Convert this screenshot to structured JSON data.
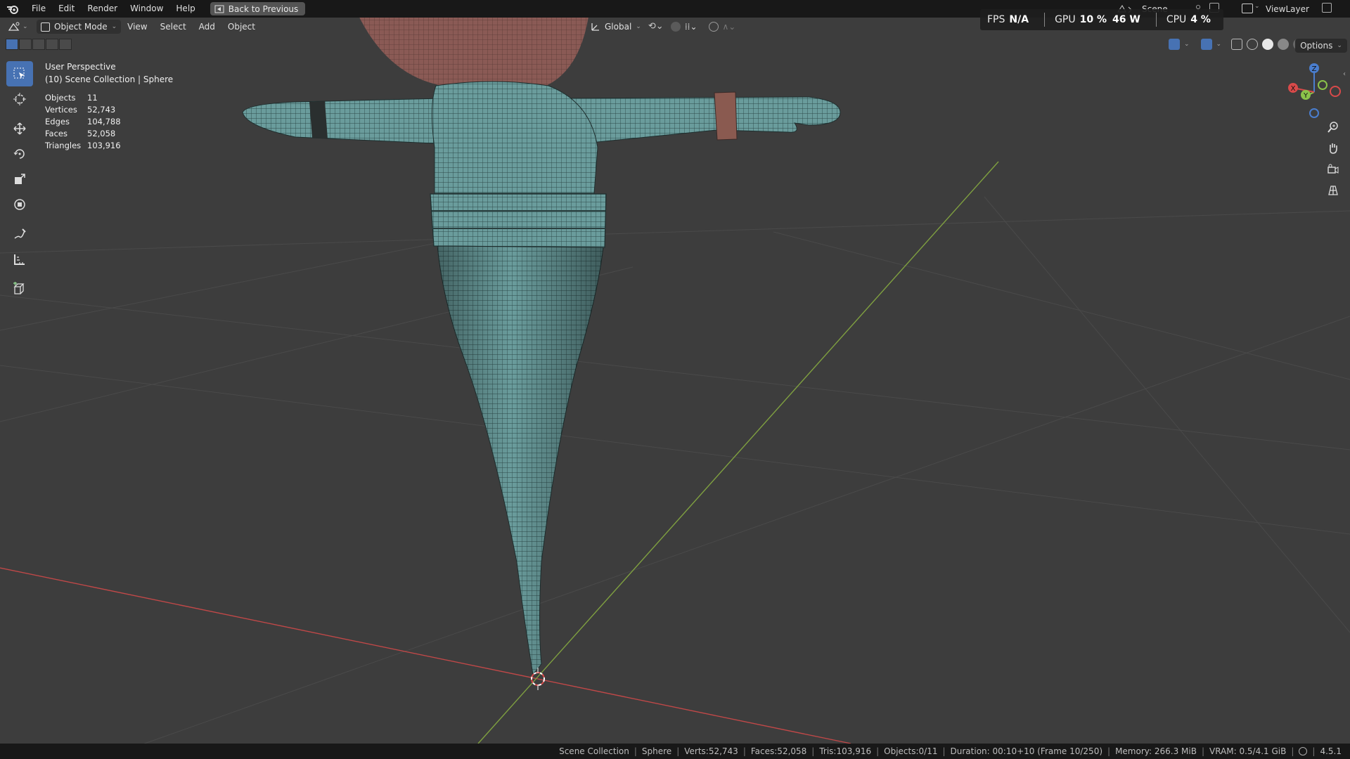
{
  "menubar": {
    "items": [
      "File",
      "Edit",
      "Render",
      "Window",
      "Help"
    ],
    "back_button": "Back to Previous",
    "scene": "Scene",
    "view_layer": "ViewLayer"
  },
  "header": {
    "mode": "Object Mode",
    "menus": [
      "View",
      "Select",
      "Add",
      "Object"
    ],
    "transform_orientation": "Global",
    "options": "Options"
  },
  "perf": {
    "fps_label": "FPS",
    "fps_value": "N/A",
    "gpu_label": "GPU",
    "gpu_value": "10 %",
    "gpu_watts": "46 W",
    "cpu_label": "CPU",
    "cpu_value": "4 %"
  },
  "viewport": {
    "view_name": "User Perspective",
    "collection_line": "(10) Scene Collection | Sphere",
    "stats": [
      {
        "label": "Objects",
        "value": "11"
      },
      {
        "label": "Vertices",
        "value": "52,743"
      },
      {
        "label": "Edges",
        "value": "104,788"
      },
      {
        "label": "Faces",
        "value": "52,058"
      },
      {
        "label": "Triangles",
        "value": "103,916"
      }
    ],
    "gizmo_axes": {
      "z": "Z",
      "y": "Y",
      "x": "X"
    }
  },
  "toolbar": {
    "tools": [
      "select-box-icon",
      "cursor-icon",
      "move-icon",
      "rotate-icon",
      "scale-icon",
      "transform-icon",
      "annotate-icon",
      "measure-icon",
      "add-cube-icon"
    ]
  },
  "statusbar": {
    "items": [
      "Scene Collection",
      "Sphere",
      "Verts:52,743",
      "Faces:52,058",
      "Tris:103,916",
      "Objects:0/11",
      "Duration: 00:10+10 (Frame 10/250)",
      "Memory: 266.3 MiB",
      "VRAM: 0.5/4.1 GiB"
    ],
    "version": "4.5.1"
  },
  "colors": {
    "mesh": "#6fa4a4",
    "accent": "#4772b3",
    "x_axis": "#d94a4a",
    "y_axis": "#8bc34a"
  }
}
